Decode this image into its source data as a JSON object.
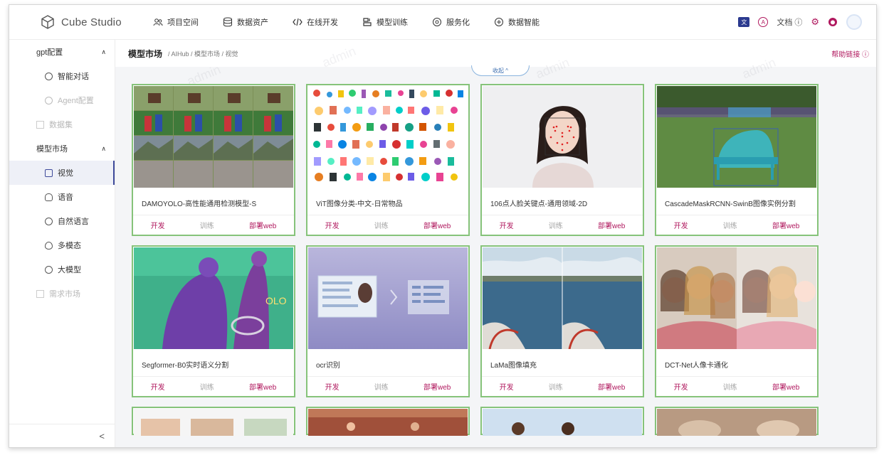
{
  "brand": {
    "name": "Cube Studio"
  },
  "nav": [
    {
      "label": "项目空间",
      "icon": "team-icon"
    },
    {
      "label": "数据资产",
      "icon": "database-icon"
    },
    {
      "label": "在线开发",
      "icon": "code-icon"
    },
    {
      "label": "模型训练",
      "icon": "train-icon"
    },
    {
      "label": "服务化",
      "icon": "service-icon"
    },
    {
      "label": "数据智能",
      "icon": "brain-icon"
    }
  ],
  "navright": {
    "doc_label": "文档"
  },
  "sidebar": {
    "group_gpt": "gpt配置",
    "item_chat": "智能对话",
    "item_agent": "Agent配置",
    "item_dataset": "数据集",
    "group_market": "模型市场",
    "item_vision": "视觉",
    "item_voice": "语音",
    "item_nlp": "自然语言",
    "item_multi": "多模态",
    "item_llm": "大模型",
    "item_demand": "需求市场",
    "collapse_arrow": "<"
  },
  "breadcrumb": {
    "title": "模型市场",
    "path": "/ AIHub / 模型市场 / 视觉",
    "help": "帮助链接 ⓘ"
  },
  "collapse_label": "收起 ^",
  "watermark": "admin",
  "actions": {
    "dev": "开发",
    "train": "训练",
    "web": "部署web"
  },
  "cards": [
    {
      "title": "DAMOYOLO-高性能通用检测模型-S"
    },
    {
      "title": "ViT图像分类-中文-日常物品"
    },
    {
      "title": "106点人脸关键点-通用领域-2D"
    },
    {
      "title": "CascadeMaskRCNN-SwinB图像实例分割"
    },
    {
      "title": "Segformer-B0实时语义分割"
    },
    {
      "title": "ocr识别"
    },
    {
      "title": "LaMa图像填充"
    },
    {
      "title": "DCT-Net人像卡通化"
    }
  ]
}
